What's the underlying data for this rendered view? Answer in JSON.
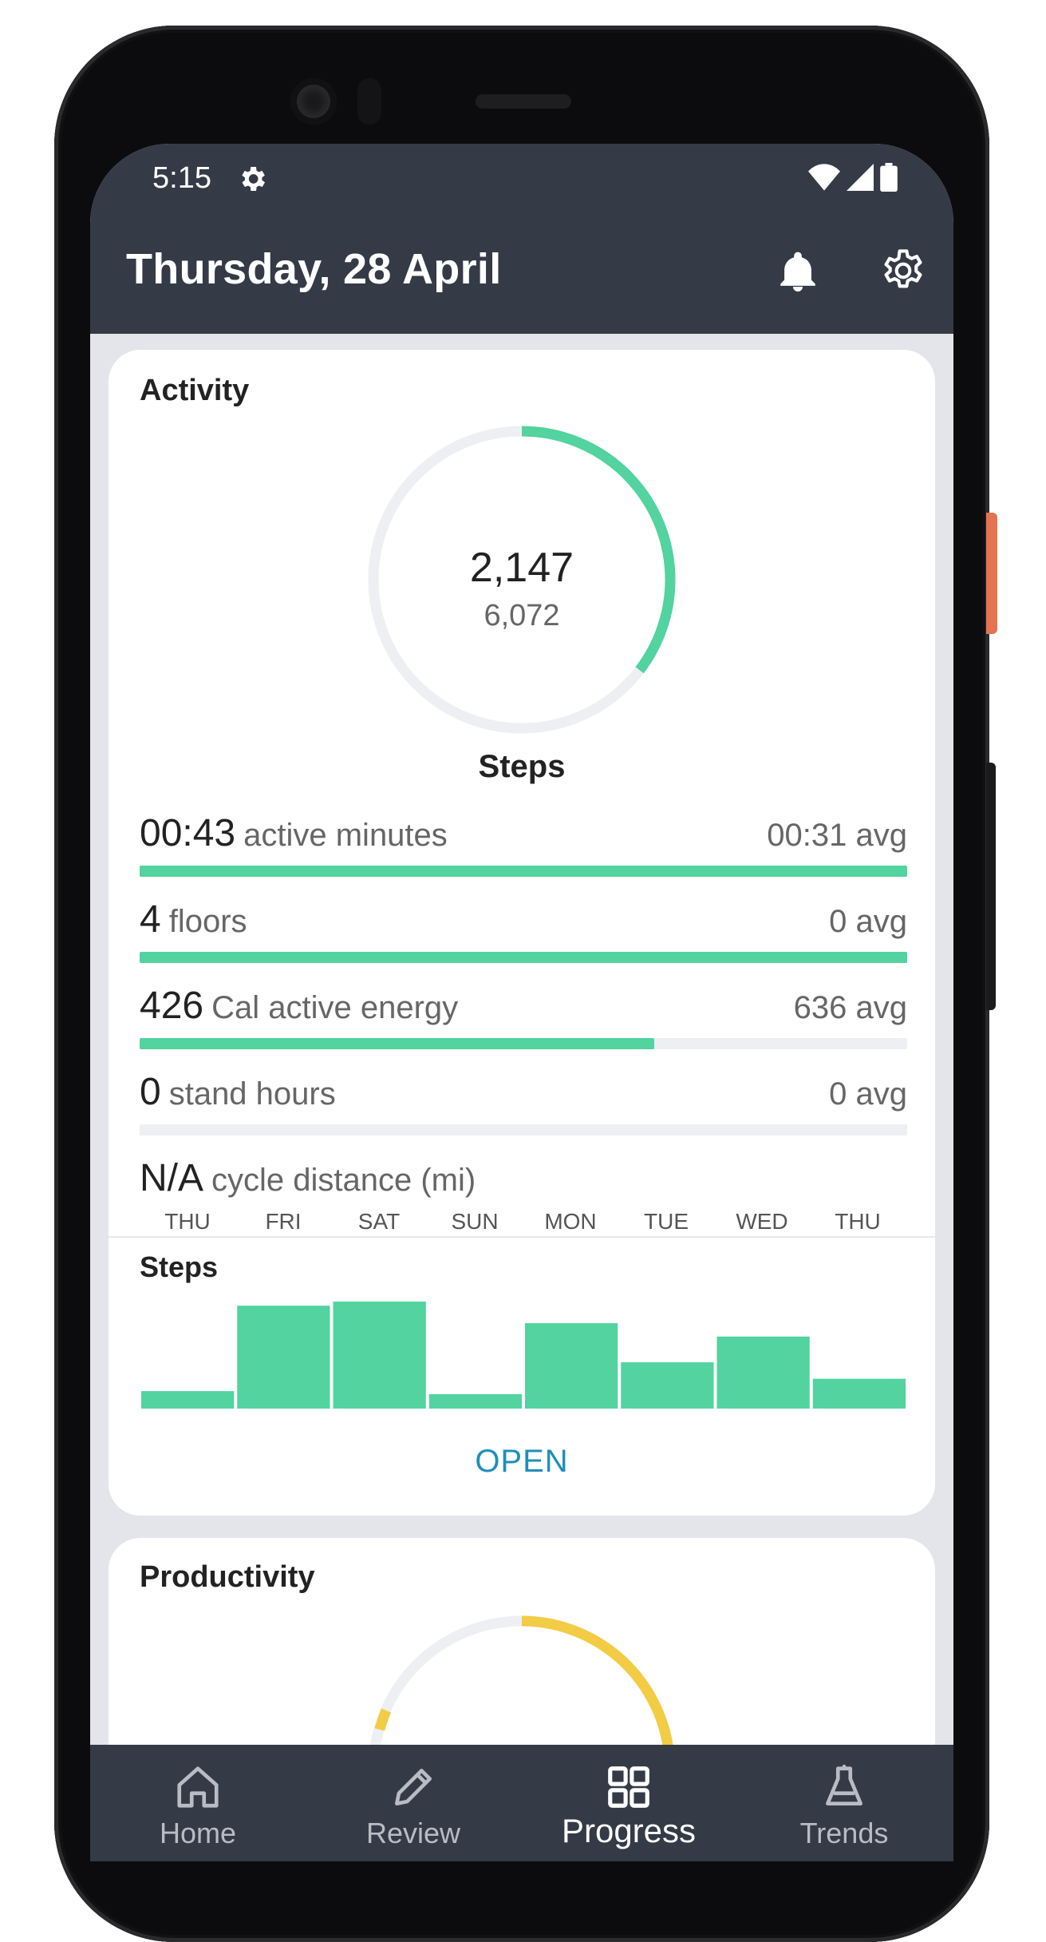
{
  "status_bar": {
    "time": "5:15"
  },
  "app_bar": {
    "title": "Thursday, 28 April"
  },
  "activity": {
    "title": "Activity",
    "ring": {
      "value": "2,147",
      "goal": "6,072",
      "label": "Steps",
      "progress": 0.354
    },
    "metrics": [
      {
        "value": "00:43",
        "label": "active minutes",
        "avg": "00:31 avg",
        "progress": 1.0
      },
      {
        "value": "4",
        "label": "floors",
        "avg": "0 avg",
        "progress": 1.0
      },
      {
        "value": "426",
        "label": "Cal active energy",
        "avg": "636 avg",
        "progress": 0.67
      },
      {
        "value": "0",
        "label": "stand hours",
        "avg": "0 avg",
        "progress": 0.0
      },
      {
        "value": "N/A",
        "label": "cycle distance (mi)"
      }
    ],
    "chart_title": "Steps",
    "open_label": "OPEN"
  },
  "chart_data": {
    "type": "bar",
    "title": "Steps",
    "categories": [
      "THU",
      "FRI",
      "SAT",
      "SUN",
      "MON",
      "TUE",
      "WED",
      "THU"
    ],
    "values": [
      17,
      100,
      104,
      14,
      83,
      45,
      70,
      29
    ],
    "ylim": [
      0,
      104
    ],
    "color": "#52d39f"
  },
  "productivity": {
    "title": "Productivity",
    "ring_color": "#f2cc44"
  },
  "bottom_nav": {
    "items": [
      {
        "label": "Home",
        "icon": "home-icon",
        "active": false
      },
      {
        "label": "Review",
        "icon": "pencil-icon",
        "active": false
      },
      {
        "label": "Progress",
        "icon": "grid-icon",
        "active": true
      },
      {
        "label": "Trends",
        "icon": "flask-icon",
        "active": false
      }
    ]
  },
  "colors": {
    "bar_background": "#343a46",
    "accent_green": "#52d39f",
    "accent_yellow": "#f2cc44",
    "link_blue": "#1e8fb8"
  }
}
